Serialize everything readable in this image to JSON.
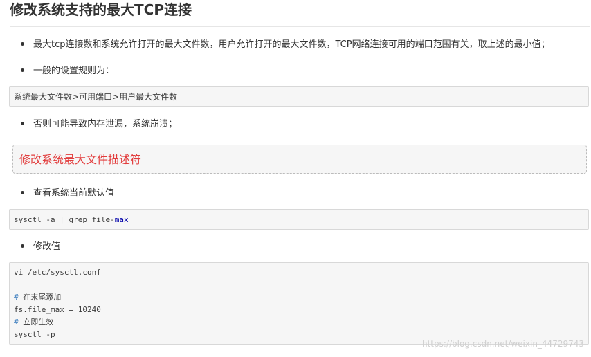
{
  "title": "修改系统支持的最大TCP连接",
  "bullets": {
    "b1": "最大tcp连接数和系统允许打开的最大文件数，用户允许打开的最大文件数，TCP网络连接可用的端口范围有关，取上述的最小值；",
    "b2": "一般的设置规则为：",
    "b3": "否则可能导致内存泄漏，系统崩溃；",
    "b4": "查看系统当前默认值",
    "b5": "修改值"
  },
  "rule_box": "系统最大文件数>可用端口>用户最大文件数",
  "callout": "修改系统最大文件描述符",
  "code1": {
    "prefix": "sysctl -a | grep file-",
    "keyword": "max"
  },
  "code2": {
    "line1": "vi /etc/sysctl.conf",
    "comment1_mark": "#",
    "comment1_text": "在末尾添加",
    "line3": "fs.file_max = 10240",
    "comment2_mark": "#",
    "comment2_text": "立即生效",
    "line5": "sysctl -p"
  },
  "watermark": "https://blog.csdn.net/weixin_44729743"
}
